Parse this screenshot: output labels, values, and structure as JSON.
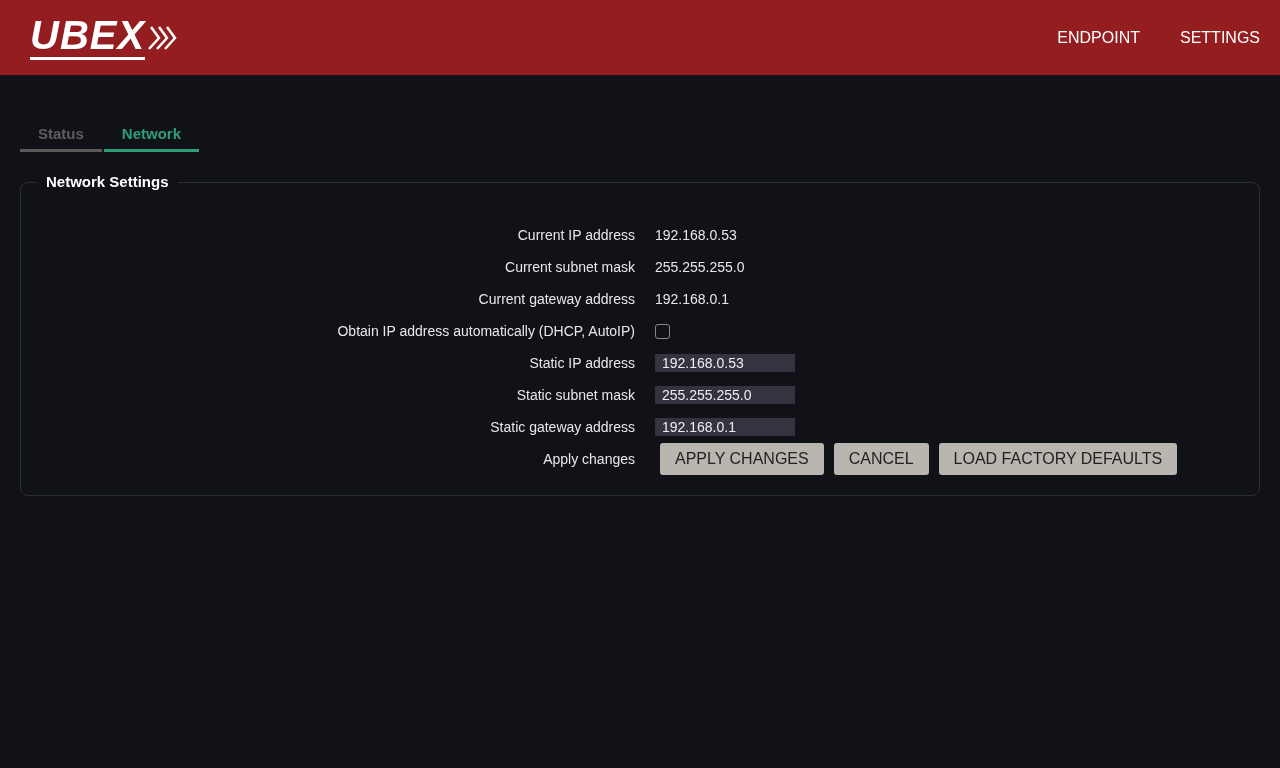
{
  "header": {
    "logo": "UBEX",
    "nav": [
      {
        "label": "ENDPOINT"
      },
      {
        "label": "SETTINGS"
      }
    ]
  },
  "tabs": [
    {
      "label": "Status",
      "selected": false
    },
    {
      "label": "Network",
      "selected": true
    }
  ],
  "panel": {
    "title": "Network Settings",
    "rows": [
      {
        "kind": "text",
        "label": "Current IP address",
        "value": "192.168.0.53"
      },
      {
        "kind": "text",
        "label": "Current subnet mask",
        "value": "255.255.255.0"
      },
      {
        "kind": "text",
        "label": "Current gateway address",
        "value": "192.168.0.1"
      },
      {
        "kind": "checkbox",
        "label": "Obtain IP address automatically (DHCP, AutoIP)",
        "checked": false
      },
      {
        "kind": "input",
        "label": "Static IP address",
        "value": "192.168.0.53"
      },
      {
        "kind": "input",
        "label": "Static subnet mask",
        "value": "255.255.255.0"
      },
      {
        "kind": "input",
        "label": "Static gateway address",
        "value": "192.168.0.1"
      },
      {
        "kind": "buttons",
        "label": "Apply changes",
        "buttons": [
          "APPLY CHANGES",
          "CANCEL",
          "LOAD FACTORY DEFAULTS"
        ]
      }
    ]
  }
}
